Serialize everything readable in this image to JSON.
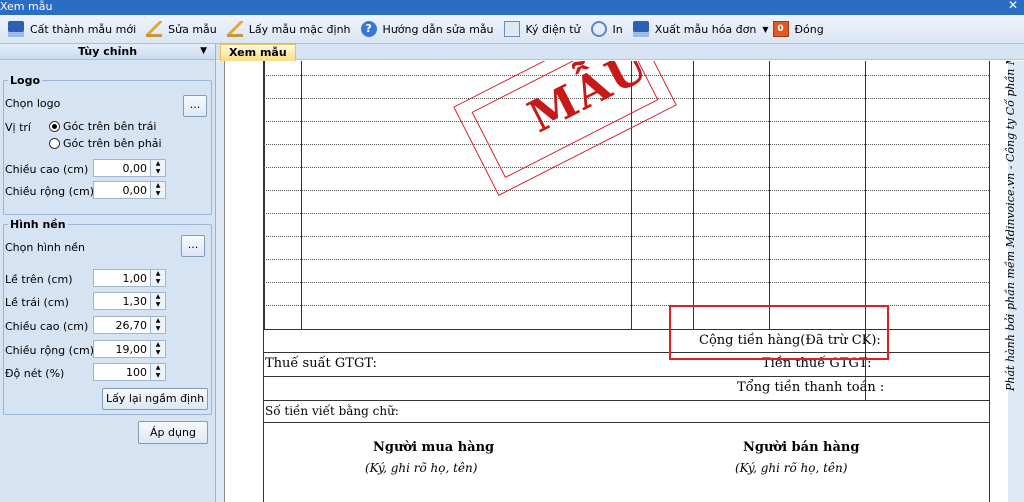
{
  "window": {
    "title": "Xem mẫu"
  },
  "toolbar": {
    "items": [
      {
        "label": "Cất thành mẫu mới",
        "icon": "save-icon"
      },
      {
        "label": "Sửa mẫu",
        "icon": "edit-icon"
      },
      {
        "label": "Lấy mẫu mặc định",
        "icon": "edit-icon"
      },
      {
        "label": "Hướng dẫn sửa mẫu",
        "icon": "help-icon"
      },
      {
        "label": "Ký điện tử",
        "icon": "sign-icon"
      },
      {
        "label": "In",
        "icon": "print-icon"
      },
      {
        "label": "Xuất mẫu hóa đơn",
        "icon": "save-icon"
      },
      {
        "label": "Đóng",
        "icon": "close-icon"
      }
    ]
  },
  "sidebar": {
    "title": "Tùy chỉnh",
    "logo": {
      "title": "Logo",
      "choose_label": "Chọn logo",
      "browse_label": "...",
      "position_label": "Vị trí",
      "position_options": [
        "Góc trên bên trái",
        "Góc trên bên phải"
      ],
      "position_selected": "Góc trên bên trái",
      "height_label": "Chiều cao (cm)",
      "height_value": "0,00",
      "width_label": "Chiều rộng (cm)",
      "width_value": "0,00"
    },
    "background": {
      "title": "Hình nền",
      "choose_label": "Chọn hình nền",
      "browse_label": "...",
      "fields": [
        {
          "label": "Lề trên (cm)",
          "value": "1,00"
        },
        {
          "label": "Lề trái (cm)",
          "value": "1,30"
        },
        {
          "label": "Chiều cao (cm)",
          "value": "26,70"
        },
        {
          "label": "Chiều rộng (cm)",
          "value": "19,00"
        },
        {
          "label": "Độ nét (%)",
          "value": "100"
        }
      ],
      "reset_label": "Lấy lại ngầm định"
    },
    "apply_label": "Áp dụng"
  },
  "tabs": {
    "active": "Xem mẫu"
  },
  "document": {
    "stamp_text": "MẪU",
    "subtotal_label": "Cộng tiền hàng(Đã trừ CK):",
    "vat_rate_label": "Thuế suất GTGT:",
    "vat_amount_label": "Tiền thuế GTGT:",
    "total_label": "Tổng tiền thanh toán :",
    "amount_in_words_label": "Số tiền viết bằng chữ:",
    "buyer_title": "Người mua hàng",
    "buyer_note": "(Ký, ghi rõ họ, tên)",
    "seller_title": "Người bán hàng",
    "seller_note": "(Ký, ghi rõ họ, tên)",
    "publisher_text": "Phát hành bởi phần mềm Mdinvoice.vn - Công ty Cổ phần MI"
  },
  "colors": {
    "accent": "#2b6cc4",
    "stamp": "#c81818",
    "highlight": "#e02020"
  }
}
